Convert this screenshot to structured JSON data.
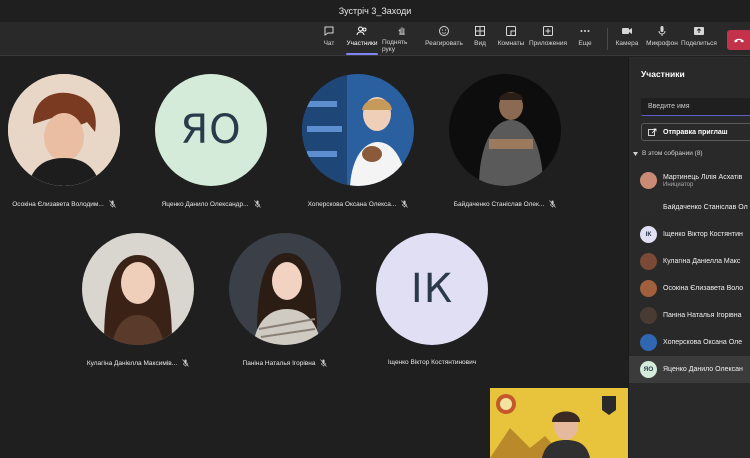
{
  "window": {
    "title": "Зустріч 3_Заходи"
  },
  "toolbar": {
    "chat": "Чат",
    "participants": "Участники",
    "raise_hand": "Поднять руку",
    "react": "Реагировать",
    "view": "Вид",
    "rooms": "Комнаты",
    "apps": "Приложения",
    "more": "Еще",
    "camera": "Камера",
    "microphone": "Микрофон",
    "share": "Поделиться"
  },
  "stage": {
    "tiles": [
      {
        "name": "Осокіна Єлизавета Володим...",
        "initials": ""
      },
      {
        "name": "Яценко Данило Олександр...",
        "initials": "ЯО"
      },
      {
        "name": "Хоперскова Оксана Олекса...",
        "initials": ""
      },
      {
        "name": "Байдаченко Станіслав Олек...",
        "initials": ""
      },
      {
        "name": "Кулагіна Даніелла Максимів...",
        "initials": ""
      },
      {
        "name": "Паніна Наталья Ігорівна",
        "initials": ""
      },
      {
        "name": "Іщенко Віктор Костянтинович",
        "initials": "ІК"
      }
    ]
  },
  "panel": {
    "title": "Участники",
    "search_placeholder": "Введите имя",
    "share_invite": "Отправка приглаш",
    "section": "В этом собрании (8)",
    "participants": [
      {
        "name": "Мартинець Лілія Асхатів",
        "role": "Инициатор",
        "initials": ""
      },
      {
        "name": "Байдаченко Станіслав Ол",
        "role": "",
        "initials": ""
      },
      {
        "name": "Іщенко Віктор Костянтин",
        "role": "",
        "initials": "ІК"
      },
      {
        "name": "Кулагіна Даніелла Макс",
        "role": "",
        "initials": ""
      },
      {
        "name": "Осокіна Єлизавета Воло",
        "role": "",
        "initials": ""
      },
      {
        "name": "Паніна Наталья Ігорівна",
        "role": "",
        "initials": ""
      },
      {
        "name": "Хоперскова Оксана Оле",
        "role": "",
        "initials": ""
      },
      {
        "name": "Яценко Данило Олексан",
        "role": "",
        "initials": "ЯО"
      }
    ]
  },
  "colors": {
    "accent": "#7f85f5",
    "leave": "#c4314b",
    "initials_bg_green": "#d4ebd9",
    "initials_bg_lavender": "#e1dff3"
  }
}
